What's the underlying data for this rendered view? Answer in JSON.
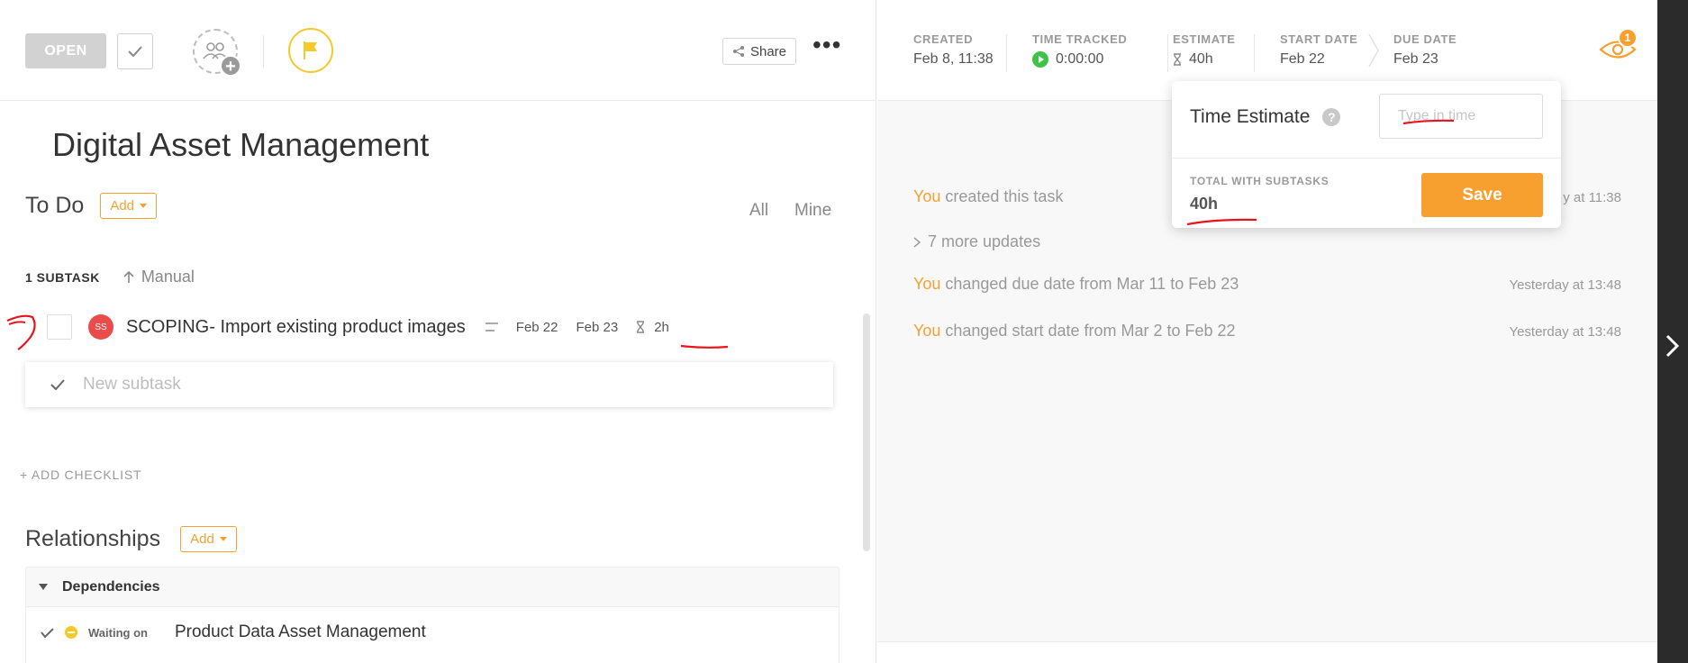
{
  "toolbar": {
    "status_label": "OPEN",
    "share_label": "Share",
    "more_label": "•••"
  },
  "task": {
    "title": "Digital Asset Management",
    "status": "To Do",
    "add_label": "Add",
    "filter_all": "All",
    "filter_mine": "Mine"
  },
  "subtasks": {
    "count_label": "1 SUBTASK",
    "sort_label": "Manual",
    "items": [
      {
        "avatar_initials": "SS",
        "name": "SCOPING- Import existing product images",
        "start": "Feb 22",
        "due": "Feb 23",
        "estimate": "2h"
      }
    ],
    "new_placeholder": "New subtask"
  },
  "checklist": {
    "add_label": "+ ADD CHECKLIST"
  },
  "relationships": {
    "title": "Relationships",
    "add_label": "Add",
    "dependencies_label": "Dependencies",
    "items": [
      {
        "status": "Waiting on",
        "name": "Product Data Asset Management"
      }
    ]
  },
  "header": {
    "created_label": "CREATED",
    "created_value": "Feb 8, 11:38",
    "time_tracked_label": "TIME TRACKED",
    "time_tracked_value": "0:00:00",
    "estimate_label": "ESTIMATE",
    "estimate_value": "40h",
    "start_date_label": "START DATE",
    "start_date_value": "Feb 22",
    "due_date_label": "DUE DATE",
    "due_date_value": "Feb 23",
    "watchers_count": "1"
  },
  "activity": {
    "items": [
      {
        "who": "You",
        "text": " created this task",
        "time": "y at 11:38"
      },
      {
        "who": "You",
        "text": " changed due date from Mar 11 to Feb 23",
        "time": "Yesterday at 13:48"
      },
      {
        "who": "You",
        "text": " changed start date from Mar 2 to Feb 22",
        "time": "Yesterday at 13:48"
      }
    ],
    "more_updates": "7 more updates"
  },
  "popover": {
    "title": "Time Estimate",
    "input_placeholder": "Type in time",
    "total_label": "TOTAL WITH SUBTASKS",
    "total_value": "40h",
    "save_label": "Save"
  },
  "colors": {
    "accent": "#f7a030",
    "flag": "#f6c92a",
    "play": "#3ec24a",
    "avatar": "#ea4b4b",
    "annotation": "#e8141b"
  }
}
